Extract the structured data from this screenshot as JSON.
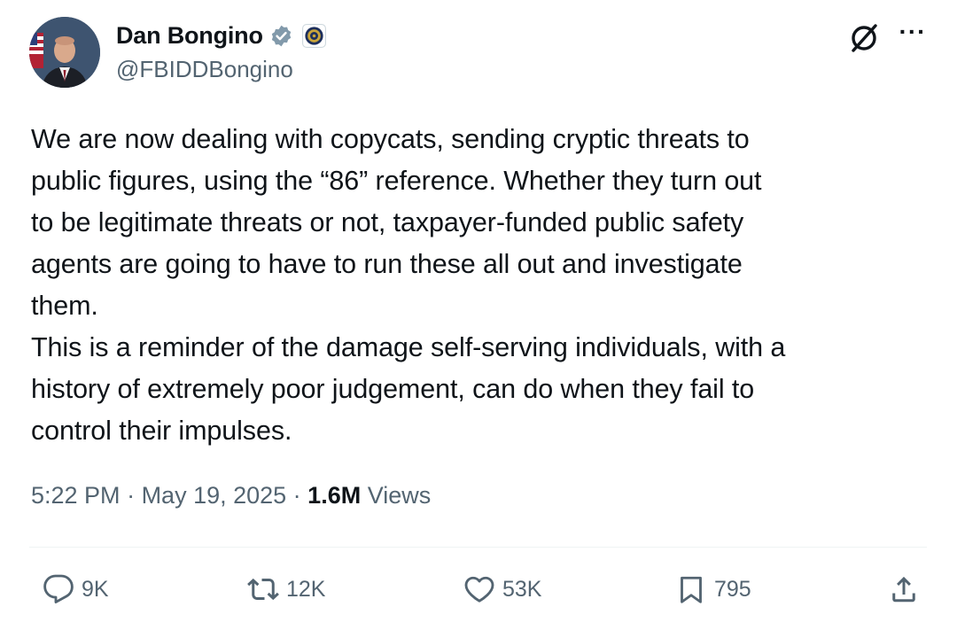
{
  "author": {
    "display_name": "Dan Bongino",
    "handle": "@FBIDDBongino",
    "verified_icon": "verified-badge-icon",
    "affiliation_icon": "fbi-seal-icon"
  },
  "header_actions": {
    "grok_icon": "grok-icon",
    "more_label": "···"
  },
  "tweet": {
    "lines": [
      "We are now dealing with copycats, sending cryptic threats to",
      "public figures, using the “86” reference. Whether they turn out",
      "to be legitimate threats or not, taxpayer-funded public safety",
      "agents are going to have to run these all out and investigate",
      "them.",
      "This is a reminder of the damage self-serving individuals, with a",
      "history of extremely poor judgement, can do when they fail to",
      "control their impulses."
    ]
  },
  "meta": {
    "time": "5:22 PM",
    "date": "May 19, 2025",
    "separator": " · ",
    "views_count": "1.6M",
    "views_label": "Views"
  },
  "actions": {
    "replies": "9K",
    "reposts": "12K",
    "likes": "53K",
    "bookmarks": "795"
  },
  "colors": {
    "text": "#0f1419",
    "secondary": "#536471",
    "verified": "#829aab",
    "divider": "#eff3f4"
  }
}
